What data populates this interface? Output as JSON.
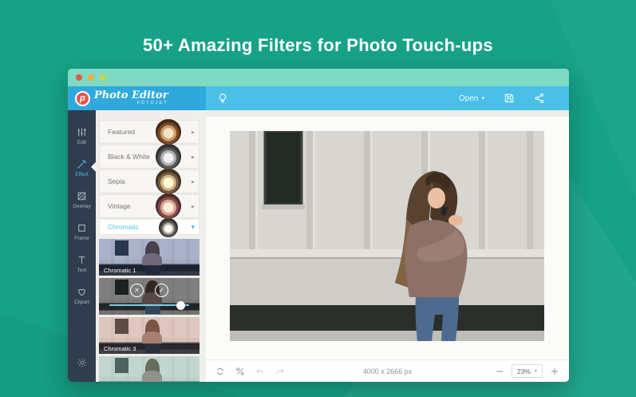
{
  "page": {
    "headline": "50+ Amazing Filters for Photo Touch-ups"
  },
  "glyphs": {
    "caret_down": "▾",
    "chevron_right": "▸",
    "chevron_down": "▾",
    "cancel": "×",
    "apply": "✓"
  },
  "window": {
    "header": {
      "logo": {
        "badge": "p",
        "name": "Photo Editor",
        "subtitle": "FOTOJET"
      },
      "open_button": {
        "label": "Open"
      }
    },
    "sidebar": {
      "items": [
        {
          "label": "Edit",
          "icon": "sliders-icon",
          "active": false
        },
        {
          "label": "Effect",
          "icon": "magic-wand-icon",
          "active": true
        },
        {
          "label": "Overlay",
          "icon": "overlay-icon",
          "active": false
        },
        {
          "label": "Frame",
          "icon": "frame-icon",
          "active": false
        },
        {
          "label": "Text",
          "icon": "text-icon",
          "active": false
        },
        {
          "label": "Clipart",
          "icon": "heart-icon",
          "active": false
        }
      ],
      "settings_icon": "gear-icon"
    },
    "filter_panel": {
      "categories": [
        {
          "label": "Featured",
          "style": "color"
        },
        {
          "label": "Black & White",
          "style": "bw"
        },
        {
          "label": "Sepia",
          "style": "sepia"
        },
        {
          "label": "Vintage",
          "style": "vintage"
        },
        {
          "label": "Chromatic",
          "style": "chromatic",
          "selected": true
        }
      ],
      "presets": [
        {
          "label": "Chromatic 1",
          "tint": "blue",
          "active": false
        },
        {
          "label": "",
          "tint": "dark",
          "active": true,
          "slider_percent": 84
        },
        {
          "label": "Chromatic 3",
          "tint": "warm",
          "active": false
        },
        {
          "label": "",
          "tint": "cool",
          "active": false
        }
      ]
    },
    "canvas": {
      "image_dimensions": "4000 x 2666 px",
      "zoom_level": "23%"
    }
  },
  "colors": {
    "teal_background": "#17A287",
    "titlebar_mint": "#7EDAC2",
    "header_blue": "#4AC0E9",
    "header_blue_dark": "#2FA9DC",
    "logo_red": "#E2574C",
    "sidebar_dark": "#2F3D4F",
    "accent_blue": "#4FC1E9",
    "panel_gray": "#EFEEEB",
    "traffic_lights": [
      "#DD5A4D",
      "#EBAF41",
      "#C9D14F"
    ]
  }
}
